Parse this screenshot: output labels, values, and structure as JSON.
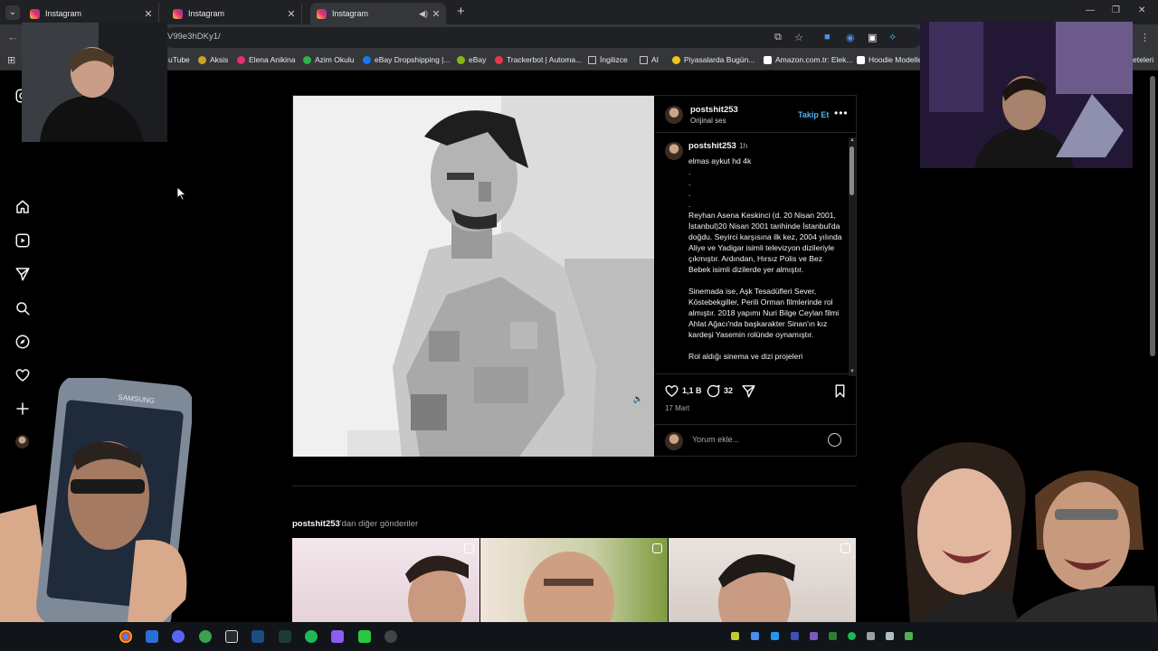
{
  "browser": {
    "tabs": [
      {
        "label": "Instagram",
        "active": false
      },
      {
        "label": "Instagram",
        "active": false
      },
      {
        "label": "Instagram",
        "active": true
      }
    ],
    "url": "V99e3hDKy1/",
    "bookmarks": [
      {
        "label": "uTube",
        "color": "#ff0000"
      },
      {
        "label": "Aksis",
        "color": "#c9a227"
      },
      {
        "label": "Elena Anikina",
        "color": "#e1306c"
      },
      {
        "label": "Azim Okulu",
        "color": "#2fb34a"
      },
      {
        "label": "eBay Dropshipping |...",
        "color": "#1877f2"
      },
      {
        "label": "eBay",
        "color": "#86b817"
      },
      {
        "label": "Trackerbot | Automa...",
        "color": "#e63946"
      },
      {
        "label": "İngilizce",
        "color": "#c7c7c7"
      },
      {
        "label": "AI",
        "color": "#c7c7c7"
      },
      {
        "label": "Piyasalarda Bugün...",
        "color": "#f0c419"
      },
      {
        "label": "Amazon.com.tr: Elek...",
        "color": "#ffffff"
      },
      {
        "label": "Hoodie Modelle",
        "color": "#ffffff"
      },
      {
        "label": "eteleri",
        "color": "#ffffff"
      }
    ]
  },
  "post": {
    "username": "postshit253",
    "audio": "Orijinal ses",
    "follow_label": "Takip Et",
    "more_label": "•••",
    "caption_user": "postshit253",
    "caption_time": "1h",
    "caption_text": "elmas aykut hd 4k\n.\n.\n.\n.\nReyhan Asena Keskinci (d. 20 Nisan 2001, İstanbul)20 Nisan 2001 tarihinde İstanbul'da doğdu. Seyirci karşısına ilk kez, 2004 yılında Aliye ve Yadigar isimli televizyon dizileriyle çıkmıştır. Ardından, Hırsız Polis ve Bez Bebek isimli dizilerde yer almıştır.\n\nSinemada ise, Aşk Tesadüfleri Sever, Köstebekgiller, Perili Orman filmlerinde rol almıştır. 2018 yapımı Nuri Bilge Ceylan filmi Ahlat Ağacı'nda başkarakter Sinan'ın kız kardeşi Yasemin rolünde oynamıştır.\n\nRol aldığı sinema ve dizi projeleri",
    "likes": "1,1 B",
    "comments": "32",
    "date": "17 Mart",
    "comment_placeholder": "Yorum ekle..."
  },
  "more_posts": {
    "user": "postshit253",
    "suffix": "'dan diğer gönderiler"
  },
  "colors": {
    "accent": "#4cb5f9",
    "background": "#000000",
    "border": "#262626"
  }
}
